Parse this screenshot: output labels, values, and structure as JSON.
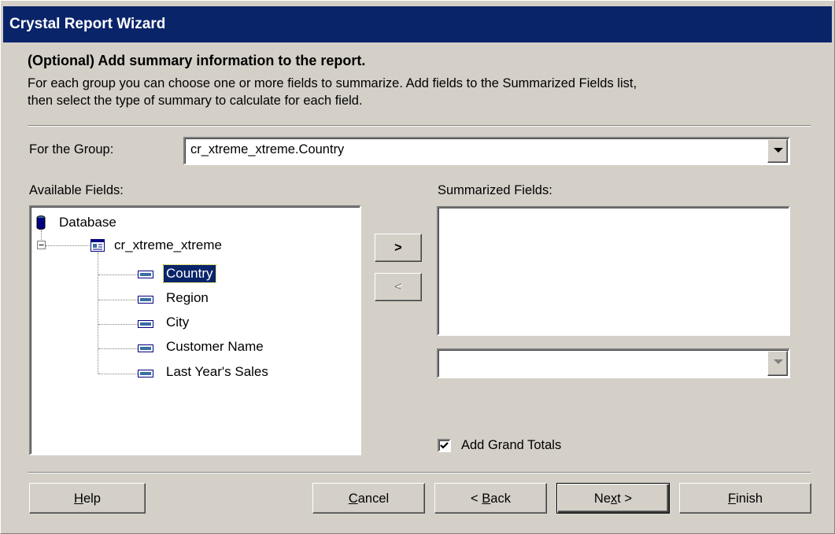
{
  "window": {
    "title": "Crystal Report Wizard"
  },
  "header": {
    "heading": "(Optional) Add summary information to the report.",
    "description_line1": "For each group you can choose one or more fields to summarize. Add fields to the Summarized Fields list,",
    "description_line2": "then select the type of summary to calculate for each field."
  },
  "group": {
    "label": "For the Group:",
    "value": "cr_xtreme_xtreme.Country"
  },
  "available": {
    "label": "Available Fields:",
    "root": "Database",
    "table": "cr_xtreme_xtreme",
    "fields": [
      "Country",
      "Region",
      "City",
      "Customer Name",
      "Last Year's Sales"
    ],
    "selected_index": 0
  },
  "transfer": {
    "add_label": ">",
    "remove_label": "<"
  },
  "summarized": {
    "label": "Summarized Fields:",
    "items": [],
    "summary_type_value": ""
  },
  "grand_totals": {
    "label": "Add Grand Totals",
    "checked": true
  },
  "buttons": {
    "help": {
      "prefix": "",
      "mnemonic": "H",
      "suffix": "elp"
    },
    "cancel": {
      "prefix": "",
      "mnemonic": "C",
      "suffix": "ancel"
    },
    "back": {
      "prefix": "< ",
      "mnemonic": "B",
      "suffix": "ack"
    },
    "next": {
      "prefix": "Ne",
      "mnemonic": "x",
      "suffix": "t >"
    },
    "finish": {
      "prefix": "",
      "mnemonic": "F",
      "suffix": "inish"
    }
  },
  "colors": {
    "titlebar": "#0a246a",
    "dialog_bg": "#d4d0c8",
    "selection": "#0a246a"
  }
}
